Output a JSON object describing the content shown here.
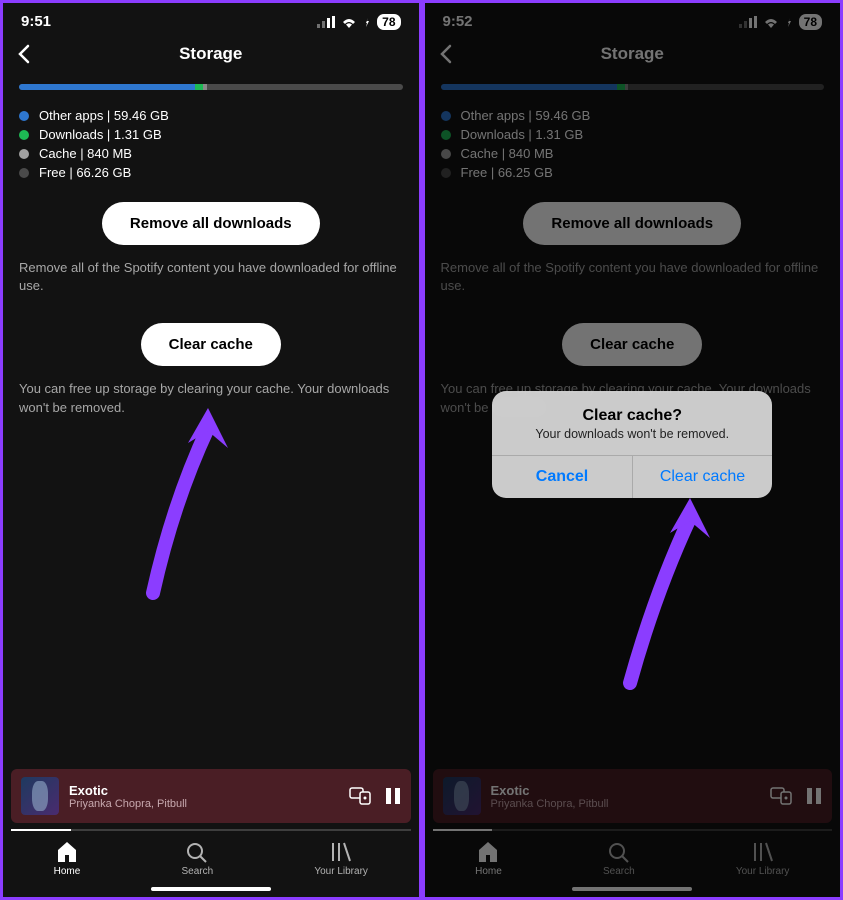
{
  "left": {
    "status": {
      "time": "9:51",
      "battery": "78"
    },
    "nav": {
      "title": "Storage"
    },
    "storage_bar": {
      "blue_pct": 46,
      "green_pct": 2,
      "grey_pct": 1
    },
    "legend": {
      "other": "Other apps | 59.46 GB",
      "downloads": "Downloads | 1.31 GB",
      "cache": "Cache | 840 MB",
      "free": "Free | 66.26 GB"
    },
    "remove_btn": "Remove all downloads",
    "remove_desc": "Remove all of the Spotify content you have downloaded for offline use.",
    "clear_btn": "Clear cache",
    "clear_desc": "You can free up storage by clearing your cache. Your downloads won't be removed.",
    "now_playing": {
      "title": "Exotic",
      "artist": "Priyanka Chopra, Pitbull",
      "progress_pct": 15
    },
    "tabs": {
      "home": "Home",
      "search": "Search",
      "library": "Your Library"
    }
  },
  "right": {
    "status": {
      "time": "9:52",
      "battery": "78"
    },
    "nav": {
      "title": "Storage"
    },
    "storage_bar": {
      "blue_pct": 46,
      "green_pct": 2,
      "grey_pct": 1
    },
    "legend": {
      "other": "Other apps | 59.46 GB",
      "downloads": "Downloads | 1.31 GB",
      "cache": "Cache | 840 MB",
      "free": "Free | 66.25 GB"
    },
    "remove_btn": "Remove all downloads",
    "remove_desc": "Remove all of the Spotify content you have downloaded for offline use.",
    "clear_btn": "Clear cache",
    "clear_desc": "You can free up storage by clearing your cache. Your downloads won't be removed.",
    "alert": {
      "title": "Clear cache?",
      "message": "Your downloads won't be removed.",
      "cancel": "Cancel",
      "confirm": "Clear cache"
    },
    "now_playing": {
      "title": "Exotic",
      "artist": "Priyanka Chopra, Pitbull",
      "progress_pct": 15
    },
    "tabs": {
      "home": "Home",
      "search": "Search",
      "library": "Your Library"
    }
  },
  "arrow_color": "#8b3dff"
}
